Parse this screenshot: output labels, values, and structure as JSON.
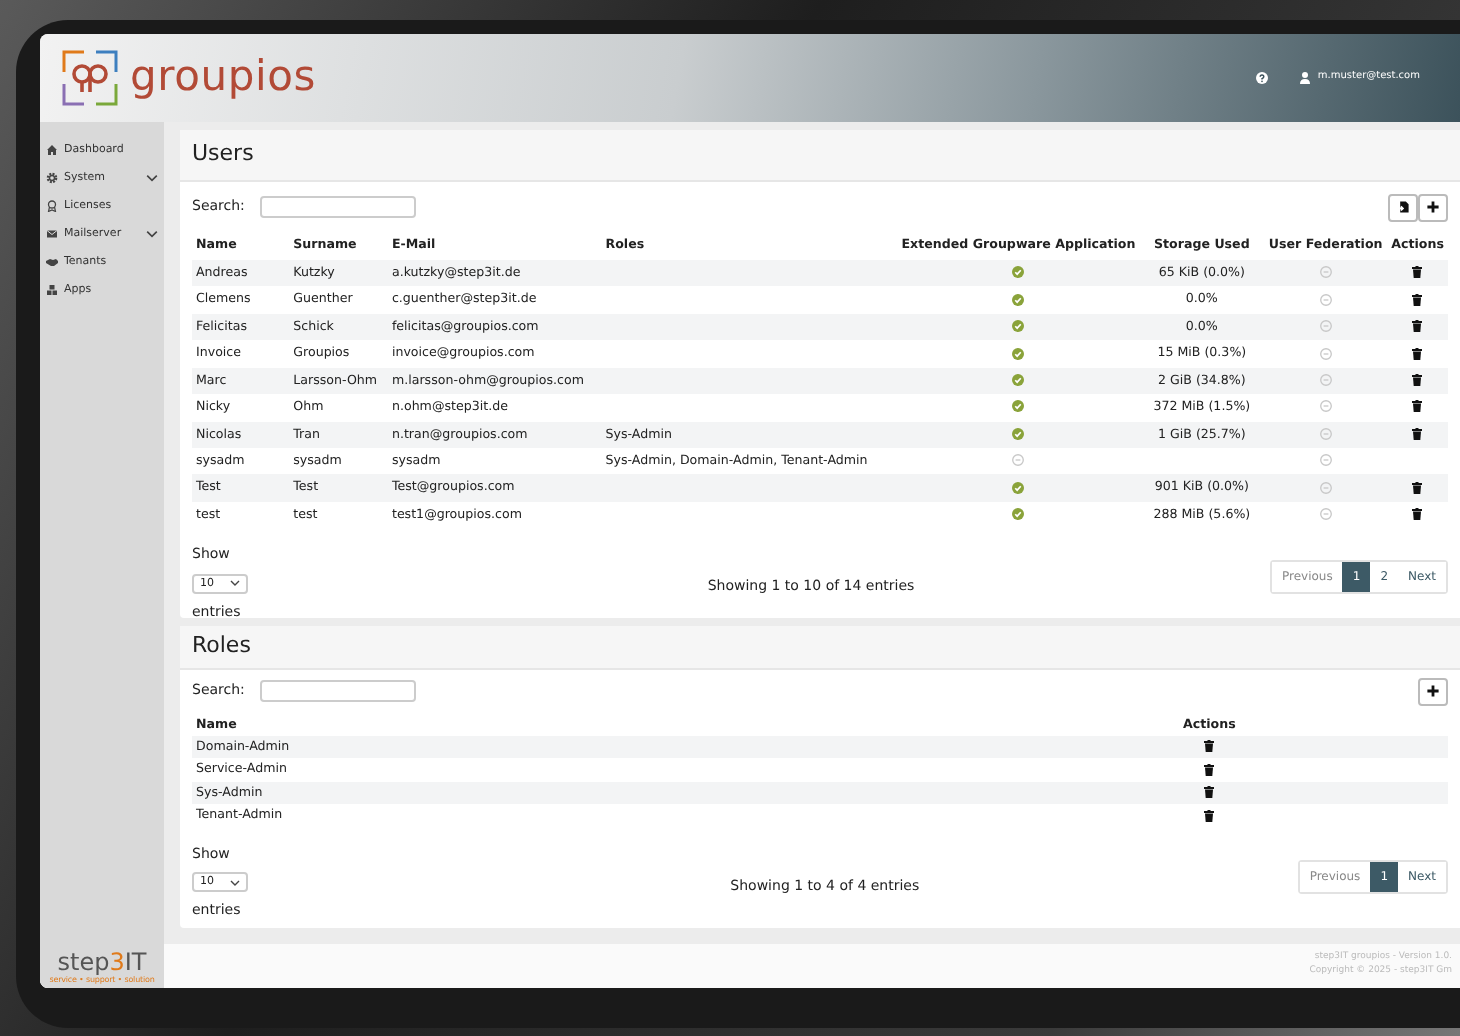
{
  "header": {
    "logo_text": "groupios",
    "user": "m.muster@test.com"
  },
  "sidebar": {
    "items": [
      {
        "label": "Dashboard",
        "has_submenu": false
      },
      {
        "label": "System",
        "has_submenu": true
      },
      {
        "label": "Licenses",
        "has_submenu": false
      },
      {
        "label": "Mailserver",
        "has_submenu": true
      },
      {
        "label": "Tenants",
        "has_submenu": false
      },
      {
        "label": "Apps",
        "has_submenu": false
      }
    ]
  },
  "users": {
    "title": "Users",
    "search_label": "Search:",
    "columns": [
      "Name",
      "Surname",
      "E-Mail",
      "Roles",
      "Extended Groupware Application",
      "Storage Used",
      "User Federation",
      "Actions"
    ],
    "rows": [
      {
        "name": "Andreas",
        "surname": "Kutzky",
        "email": "a.kutzky@step3it.de",
        "groupware": true,
        "storage": "65 KiB (0.0%)",
        "federation": false,
        "deletable": true
      },
      {
        "name": "Clemens",
        "surname": "Guenther",
        "email": "c.guenther@step3it.de",
        "groupware": true,
        "storage": "0.0%",
        "federation": false,
        "deletable": true
      },
      {
        "name": "Felicitas",
        "surname": "Schick",
        "email": "felicitas@groupios.com",
        "groupware": true,
        "storage": "0.0%",
        "federation": false,
        "deletable": true
      },
      {
        "name": "Invoice",
        "surname": "Groupios",
        "email": "invoice@groupios.com",
        "groupware": true,
        "storage": "15 MiB (0.3%)",
        "federation": false,
        "deletable": true
      },
      {
        "name": "Marc",
        "surname": "Larsson-Ohm",
        "email": "m.larsson-ohm@groupios.com",
        "groupware": true,
        "storage": "2 GiB (34.8%)",
        "federation": false,
        "deletable": true
      },
      {
        "name": "Nicky",
        "surname": "Ohm",
        "email": "n.ohm@step3it.de",
        "groupware": true,
        "storage": "372 MiB (1.5%)",
        "federation": false,
        "deletable": true
      },
      {
        "name": "Nicolas",
        "surname": "Tran",
        "email": "n.tran@groupios.com",
        "roles": "Sys-Admin",
        "groupware": true,
        "storage": "1 GiB (25.7%)",
        "federation": false,
        "deletable": true
      },
      {
        "name": "sysadm",
        "surname": "sysadm",
        "email": "sysadm",
        "roles": "Sys-Admin, Domain-Admin, Tenant-Admin",
        "groupware": false,
        "federation": false,
        "deletable": false
      },
      {
        "name": "Test",
        "surname": "Test",
        "email": "Test@groupios.com",
        "groupware": true,
        "storage": "901 KiB (0.0%)",
        "federation": false,
        "deletable": true
      },
      {
        "name": "test",
        "surname": "test",
        "email": "test1@groupios.com",
        "groupware": true,
        "storage": "288 MiB (5.6%)",
        "federation": false,
        "deletable": true
      }
    ],
    "show_label": "Show",
    "page_size": "10",
    "entries_label": "entries",
    "info": "Showing 1 to 10 of 14 entries",
    "pagination": [
      {
        "label": "Previous",
        "selected": false
      },
      {
        "label": "1",
        "selected": true
      },
      {
        "label": "2",
        "selected": false
      },
      {
        "label": "Next",
        "selected": false
      }
    ]
  },
  "roles": {
    "title": "Roles",
    "search_label": "Search:",
    "columns": [
      "Name",
      "Actions"
    ],
    "rows": [
      {
        "name": "Domain-Admin",
        "deletable": true
      },
      {
        "name": "Service-Admin",
        "deletable": true
      },
      {
        "name": "Sys-Admin",
        "deletable": true
      },
      {
        "name": "Tenant-Admin",
        "deletable": true
      }
    ],
    "show_label": "Show",
    "page_size": "10",
    "entries_label": "entries",
    "info": "Showing 1 to 4 of 4 entries",
    "pagination": [
      {
        "label": "Previous",
        "selected": false
      },
      {
        "label": "1",
        "selected": true
      },
      {
        "label": "Next",
        "selected": false
      }
    ]
  },
  "company_logo": {
    "parts": [
      {
        "text": "step",
        "accent": false
      },
      {
        "text": "3",
        "accent": true
      },
      {
        "text": "IT",
        "accent": false
      }
    ],
    "tagline": "service • support • solution"
  },
  "footer": {
    "lines": [
      "step3IT groupios - Version 1.0.",
      "Copyright © 2025 - step3IT Gm"
    ]
  }
}
